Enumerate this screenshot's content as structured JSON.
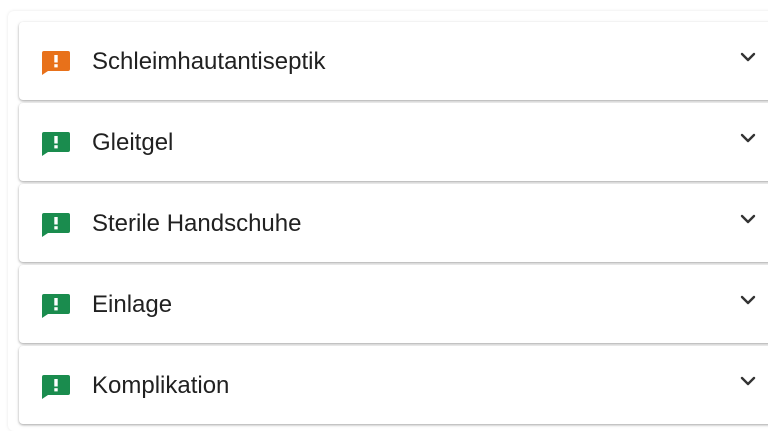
{
  "colors": {
    "warning": "#E8711A",
    "ok": "#1A8C4E",
    "text": "#212121",
    "chevron": "#333333"
  },
  "panels": [
    {
      "label": "Schleimhautantiseptik",
      "status": "warning",
      "icon": "feedback-icon",
      "expand_icon": "chevron-down-icon"
    },
    {
      "label": "Gleitgel",
      "status": "ok",
      "icon": "feedback-icon",
      "expand_icon": "chevron-down-icon"
    },
    {
      "label": "Sterile Handschuhe",
      "status": "ok",
      "icon": "feedback-icon",
      "expand_icon": "chevron-down-icon"
    },
    {
      "label": "Einlage",
      "status": "ok",
      "icon": "feedback-icon",
      "expand_icon": "chevron-down-icon"
    },
    {
      "label": "Komplikation",
      "status": "ok",
      "icon": "feedback-icon",
      "expand_icon": "chevron-down-icon"
    }
  ]
}
